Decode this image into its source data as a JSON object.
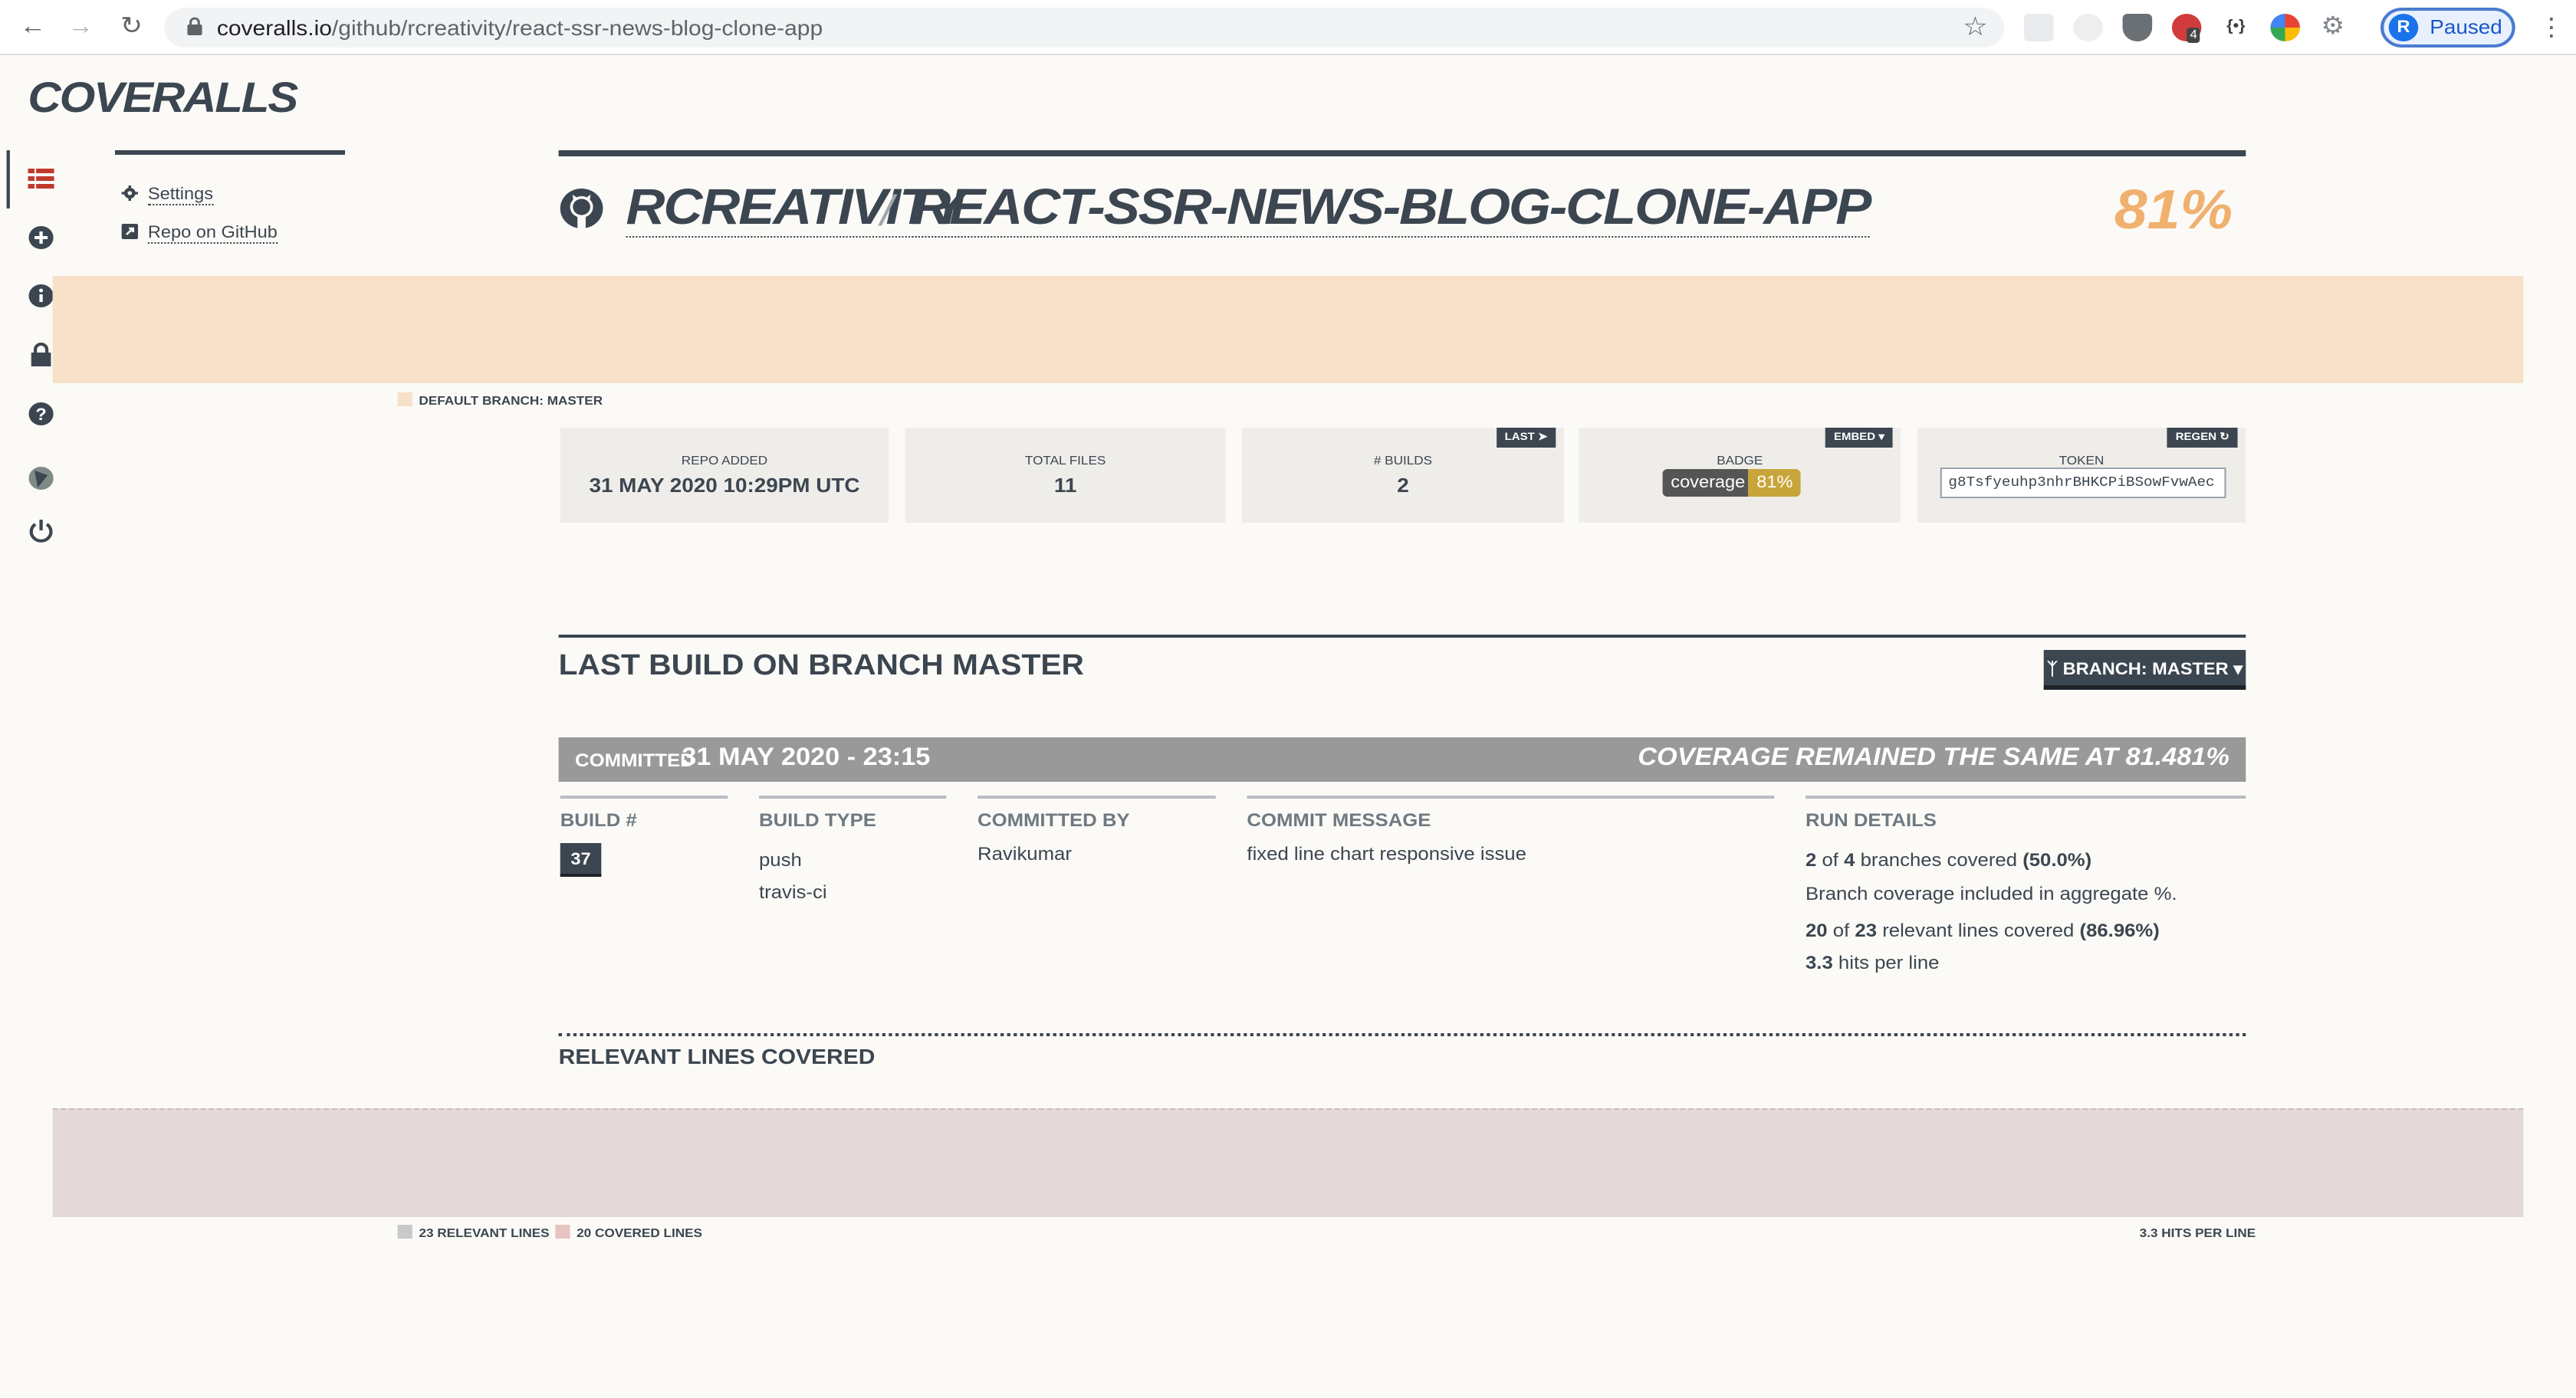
{
  "browser": {
    "url_host": "coveralls.io",
    "url_path": "/github/rcreativity/react-ssr-news-blog-clone-app",
    "profile_initial": "R",
    "profile_status": "Paused",
    "extension_badge_count": "4"
  },
  "logo": "COVERALLS",
  "side_menu": {
    "settings": "Settings",
    "repo_on_github": "Repo on GitHub"
  },
  "repo": {
    "owner": "RCREATIVITY",
    "separator": "/",
    "name": "REACT-SSR-NEWS-BLOG-CLONE-APP",
    "coverage_percent": "81%",
    "default_branch_label": "DEFAULT BRANCH: MASTER"
  },
  "stats": {
    "repo_added_label": "REPO ADDED",
    "repo_added_value": "31 MAY 2020 10:29PM UTC",
    "total_files_label": "TOTAL FILES",
    "total_files_value": "11",
    "builds_label": "# BUILDS",
    "builds_value": "2",
    "builds_button": "LAST",
    "badge_label": "BADGE",
    "badge_button": "EMBED",
    "badge_left": "coverage",
    "badge_right": "81%",
    "token_label": "TOKEN",
    "token_button": "REGEN",
    "token_value": "g8Tsfyeuhp3nhrBHKCPiBSowFvwAec"
  },
  "last_build": {
    "title": "LAST BUILD ON BRANCH MASTER",
    "branch_button": "BRANCH: MASTER",
    "committed_label": "COMMITTED",
    "committed_date": "31 MAY 2020 - 23:15",
    "coverage_status": "COVERAGE REMAINED THE SAME AT 81.481%"
  },
  "columns": {
    "build_num_head": "BUILD #",
    "build_num": "37",
    "build_type_head": "BUILD TYPE",
    "build_type_1": "push",
    "build_type_2": "travis-ci",
    "committed_by_head": "COMMITTED BY",
    "committed_by": "Ravikumar",
    "commit_message_head": "COMMIT MESSAGE",
    "commit_message": "fixed line chart responsive issue",
    "run_details_head": "RUN DETAILS",
    "branches_covered": "2",
    "branches_total": "4",
    "branches_text": "branches covered",
    "branches_pct": "(50.0%)",
    "of_word": "of",
    "branch_note": "Branch coverage included in aggregate %.",
    "lines_covered": "20",
    "lines_total": "23",
    "lines_text": "relevant lines covered",
    "lines_pct": "(86.96%)",
    "hits_value": "3.3",
    "hits_text": "hits per line"
  },
  "relevant": {
    "title": "RELEVANT LINES COVERED",
    "legend_relevant": "23 RELEVANT LINES",
    "legend_covered": "20 COVERED LINES",
    "legend_hits": "3.3 HITS PER LINE"
  },
  "colors": {
    "accent": "#f0b06e",
    "dark": "#3c4650",
    "coverage_band": "#f8e1c9",
    "lines_band": "#e3d9d8",
    "commit_bar": "#999999"
  }
}
